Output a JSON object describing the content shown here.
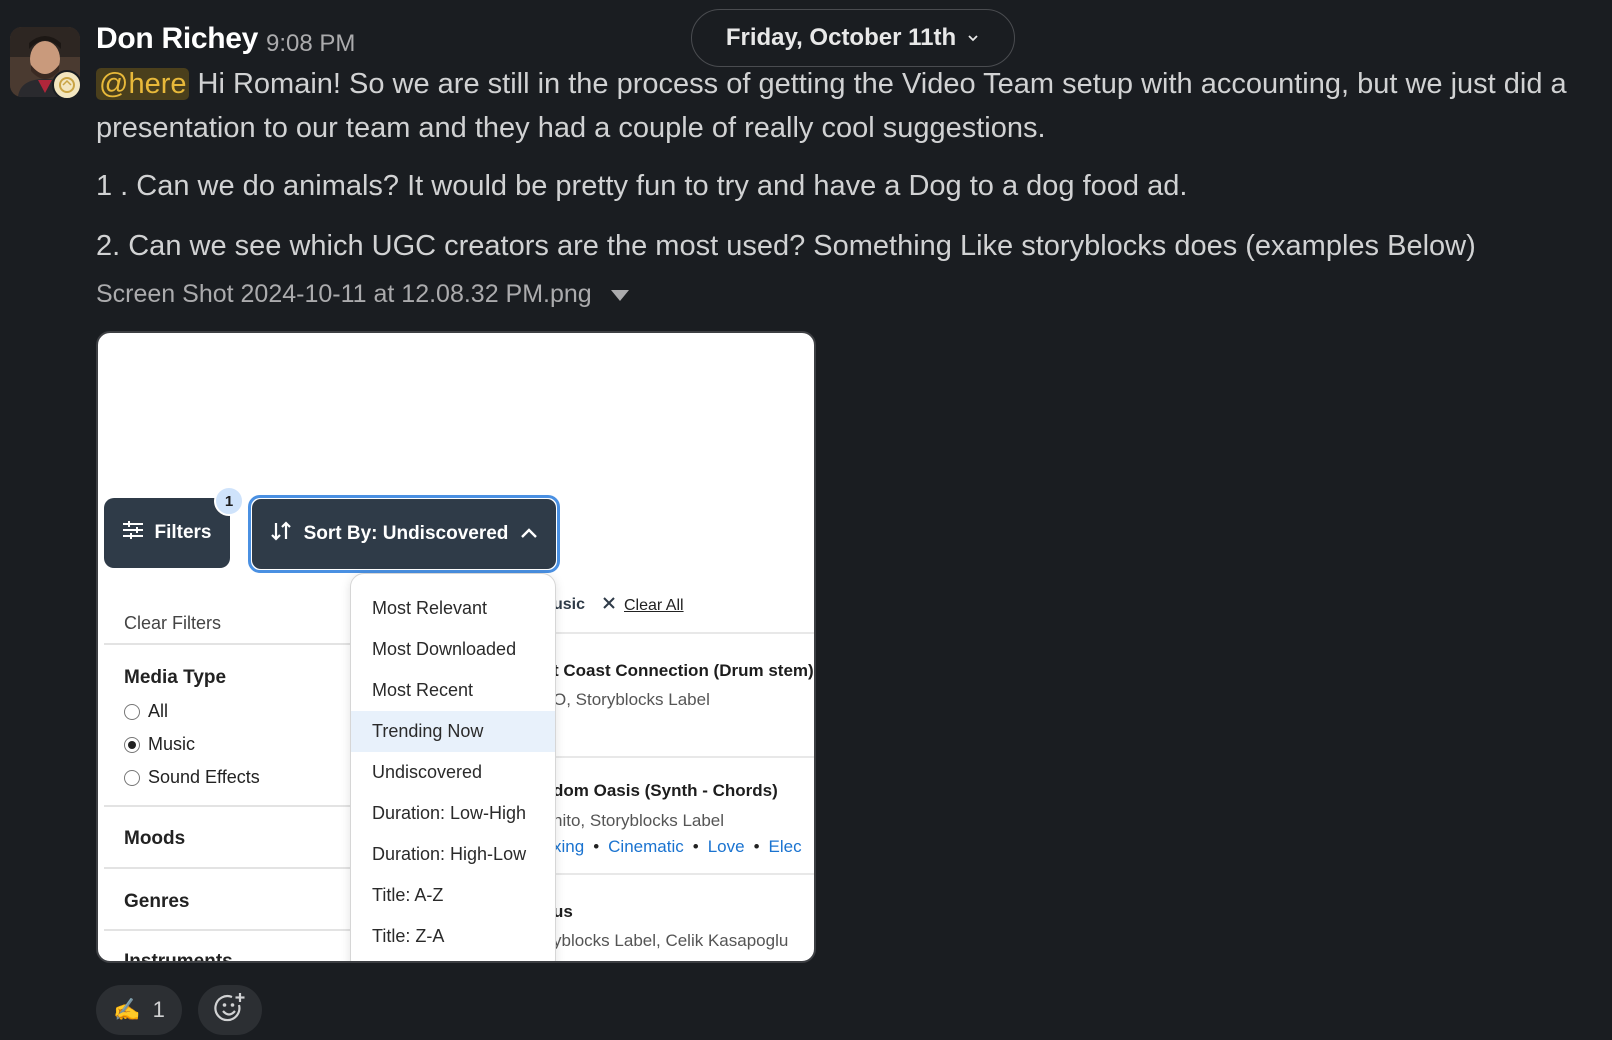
{
  "message": {
    "sender": "Don Richey",
    "time": "9:08 PM",
    "mention": "@here",
    "line1": " Hi Romain! So we are still in the process of getting the Video Team setup with accounting, but we just did a presentation to our team and they had a couple of really cool suggestions.",
    "line2": "1 . Can we do animals? It would be pretty fun to try and have a Dog to a dog food ad.",
    "line3": "2. Can we see which UGC creators are the most used? Something Like storyblocks does (examples Below)"
  },
  "date_divider": "Friday, October 11th",
  "attachment": {
    "filename": "Screen Shot 2024-10-11 at 12.08.32 PM.png"
  },
  "screenshot": {
    "filters_label": "Filters",
    "filters_badge": "1",
    "sort_label": "Sort By: Undiscovered",
    "clear_filters": "Clear Filters",
    "media_type_title": "Media Type",
    "media_options": [
      "All",
      "Music",
      "Sound Effects"
    ],
    "moods": "Moods",
    "genres": "Genres",
    "instruments": "Instruments",
    "chip_label": "usic",
    "clear_all": "Clear All",
    "sort_options": [
      "Most Relevant",
      "Most Downloaded",
      "Most Recent",
      "Trending Now",
      "Undiscovered",
      "Duration: Low-High",
      "Duration: High-Low",
      "Title: A-Z",
      "Title: Z-A"
    ],
    "results": [
      {
        "title": "t Coast Connection (Drum stem)",
        "sub": "O, Storyblocks Label"
      },
      {
        "title": "dom Oasis (Synth - Chords)",
        "sub": "nito, Storyblocks Label"
      },
      {
        "title": "us",
        "sub": "yblocks Label, Celik Kasapoglu"
      }
    ],
    "tags": [
      "xing",
      "Cinematic",
      "Love",
      "Elec"
    ]
  },
  "reaction": {
    "emoji": "✍️",
    "count": "1"
  },
  "icons": [
    "chevron-down-icon",
    "caret-down-icon",
    "sliders-icon",
    "sort-icon",
    "chevron-up-icon",
    "close-icon",
    "add-reaction-icon"
  ]
}
